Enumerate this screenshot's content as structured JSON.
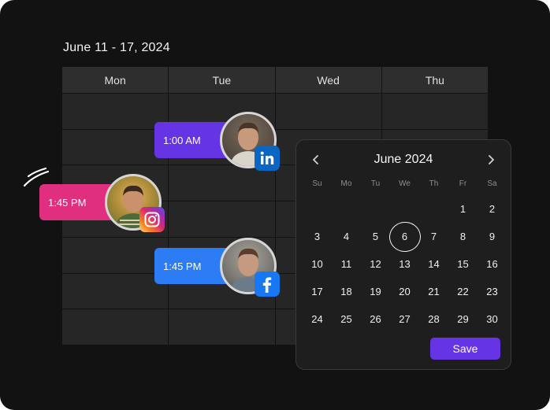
{
  "header": {
    "date_range": "June 11 - 17, 2024"
  },
  "week_view": {
    "days": [
      "Mon",
      "Tue",
      "Wed",
      "Thu"
    ],
    "events": [
      {
        "time": "1:00 AM",
        "network": "linkedin-icon",
        "color": "#6534e4"
      },
      {
        "time": "1:45 PM",
        "network": "instagram-icon",
        "color": "#e02f7e"
      },
      {
        "time": "1:45 PM",
        "network": "facebook-icon",
        "color": "#2b7cf5"
      }
    ]
  },
  "date_picker": {
    "month_label": "June 2024",
    "weekdays": [
      "Su",
      "Mo",
      "Tu",
      "We",
      "Th",
      "Fr",
      "Sa"
    ],
    "leading_blanks": 5,
    "days": [
      "1",
      "2",
      "3",
      "4",
      "5",
      "6",
      "7",
      "8",
      "9",
      "10",
      "11",
      "12",
      "13",
      "14",
      "15",
      "16",
      "17",
      "18",
      "19",
      "20",
      "21",
      "22",
      "23",
      "24",
      "25",
      "26",
      "27",
      "28",
      "29",
      "30"
    ],
    "selected_day": "6",
    "save_label": "Save",
    "accent_color": "#6534e4"
  }
}
